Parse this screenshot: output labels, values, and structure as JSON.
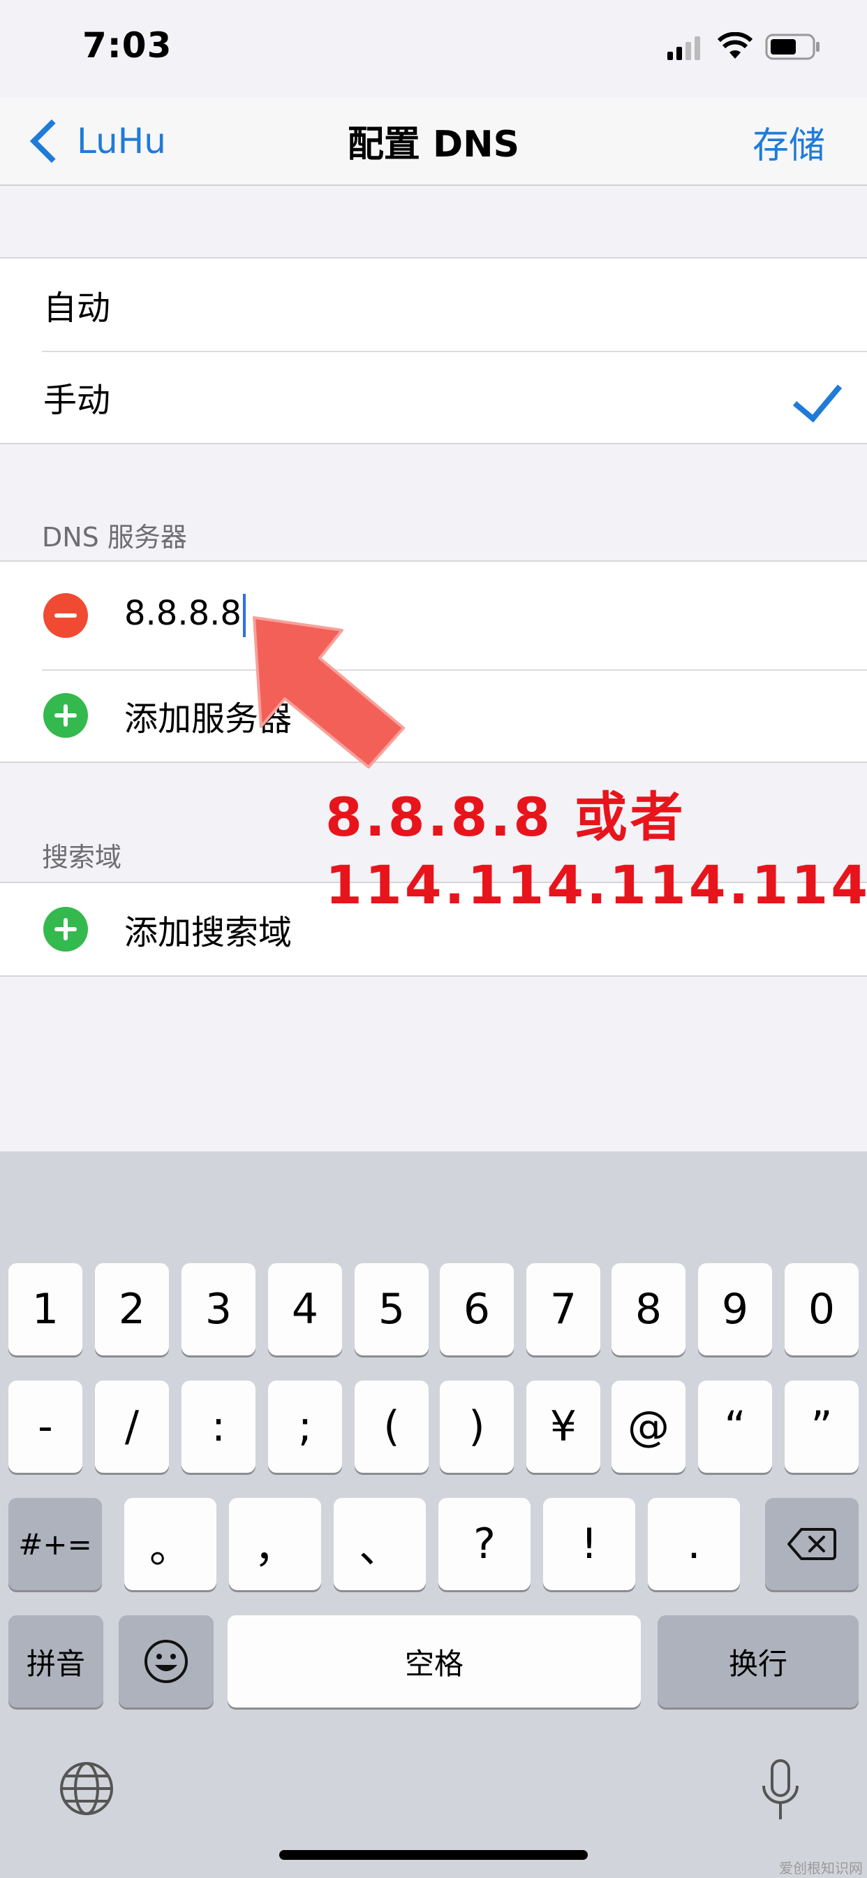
{
  "status_bar": {
    "time": "7:03"
  },
  "nav": {
    "back_label": "LuHu",
    "title": "配置 DNS",
    "save_label": "存储"
  },
  "dns_mode": {
    "options": [
      "自动",
      "手动"
    ],
    "selected": "手动"
  },
  "dns_servers": {
    "section_title": "DNS 服务器",
    "entries": [
      "8.8.8.8"
    ],
    "add_label": "添加服务器"
  },
  "search_domains": {
    "section_title": "搜索域",
    "add_label": "添加搜索域"
  },
  "annotation": {
    "line1": "8.8.8.8 或者",
    "line2": "114.114.114.114",
    "color": "#e8141c"
  },
  "keyboard": {
    "row1": [
      "1",
      "2",
      "3",
      "4",
      "5",
      "6",
      "7",
      "8",
      "9",
      "0"
    ],
    "row2": [
      "-",
      "/",
      ":",
      ";",
      "(",
      ")",
      "¥",
      "@",
      "“",
      "”"
    ],
    "row3_mode": "#+=",
    "row3": [
      "。",
      "，",
      "、",
      "?",
      "!",
      "."
    ],
    "pinyin": "拼音",
    "space": "空格",
    "return": "换行"
  },
  "colors": {
    "accent": "#1f7bd8",
    "delete": "#f04a32",
    "add": "#34b94e"
  },
  "watermark": "爱创根知识网"
}
